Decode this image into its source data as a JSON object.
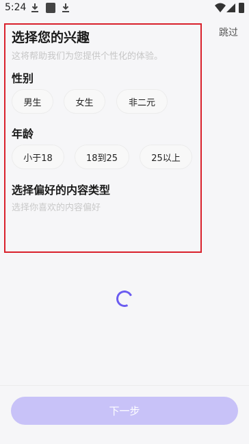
{
  "status_bar": {
    "time": "5:24",
    "icons": [
      "download-icon",
      "app-square-icon",
      "download-icon",
      "wifi-icon",
      "signal-icon",
      "battery-icon"
    ]
  },
  "header": {
    "skip_label": "跳过"
  },
  "intro": {
    "title": "选择您的兴趣",
    "subtitle": "这将帮助我们为您提供个性化的体验。"
  },
  "gender": {
    "heading": "性别",
    "options": [
      "男生",
      "女生",
      "非二元"
    ]
  },
  "age": {
    "heading": "年龄",
    "options": [
      "小于18",
      "18到25",
      "25以上"
    ]
  },
  "content_type": {
    "heading": "选择偏好的内容类型",
    "hint": "选择你喜欢的内容偏好"
  },
  "footer": {
    "next_label": "下一步"
  },
  "colors": {
    "accent": "#6b5cf0",
    "button_disabled": "#c8c2f8",
    "highlight_border": "#d9202b",
    "background": "#f6f6f8"
  }
}
